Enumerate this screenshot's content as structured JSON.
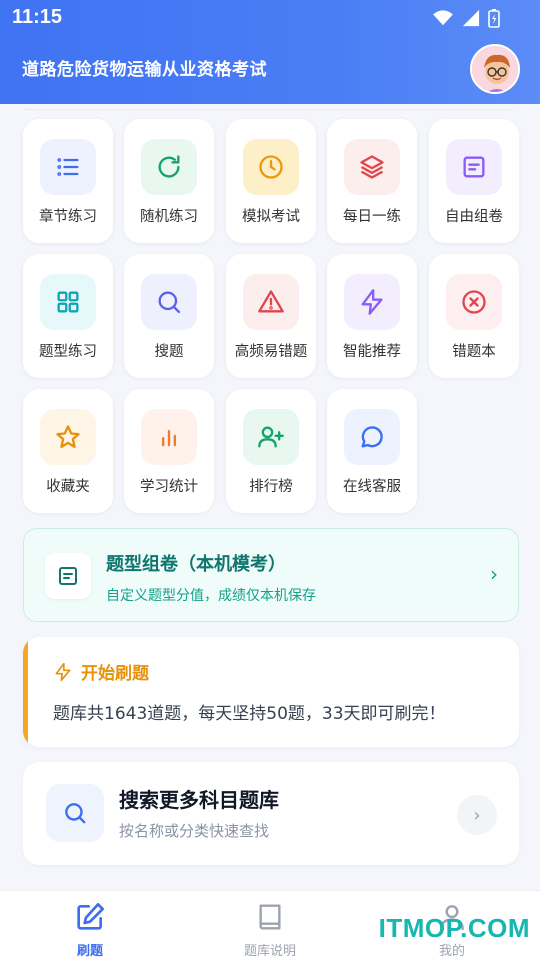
{
  "status_bar": {
    "time": "11:15"
  },
  "header": {
    "title": "道路危险货物运输从业资格考试"
  },
  "grid": [
    {
      "label": "章节练习",
      "icon": "list-icon",
      "bg": "#edf2fe",
      "color": "#3b6ef0"
    },
    {
      "label": "随机练习",
      "icon": "refresh-icon",
      "bg": "#e8f8f1",
      "color": "#16a36a"
    },
    {
      "label": "模拟考试",
      "icon": "clock-icon",
      "bg": "#fdefc8",
      "color": "#e89a0c"
    },
    {
      "label": "每日一练",
      "icon": "layers-icon",
      "bg": "#fdeeee",
      "color": "#e0474c"
    },
    {
      "label": "自由组卷",
      "icon": "file-text-icon",
      "bg": "#f2eefe",
      "color": "#8b5cf6"
    },
    {
      "label": "题型练习",
      "icon": "grid-icon",
      "bg": "#e6f8fa",
      "color": "#0ea5b7"
    },
    {
      "label": "搜题",
      "icon": "search-icon",
      "bg": "#eef0fd",
      "color": "#5b63e6"
    },
    {
      "label": "高频易错题",
      "icon": "alert-triangle-icon",
      "bg": "#fdeeee",
      "color": "#e0474c"
    },
    {
      "label": "智能推荐",
      "icon": "zap-icon",
      "bg": "#f2eefe",
      "color": "#8b5cf6"
    },
    {
      "label": "错题本",
      "icon": "x-circle-icon",
      "bg": "#fdeef0",
      "color": "#e0474c"
    },
    {
      "label": "收藏夹",
      "icon": "star-icon",
      "bg": "#fef5e6",
      "color": "#e8920c"
    },
    {
      "label": "学习统计",
      "icon": "bar-chart-icon",
      "bg": "#fff2ea",
      "color": "#f07a2f"
    },
    {
      "label": "排行榜",
      "icon": "user-plus-icon",
      "bg": "#e8f8f1",
      "color": "#16a36a"
    },
    {
      "label": "在线客服",
      "icon": "message-circle-icon",
      "bg": "#edf2fe",
      "color": "#3b6ef0"
    }
  ],
  "banner": {
    "title": "题型组卷（本机模考）",
    "subtitle": "自定义题型分值，成绩仅本机保存",
    "chevron": "›"
  },
  "start_card": {
    "title": "开始刷题",
    "text": "题库共1643道题，每天坚持50题，33天即可刷完！"
  },
  "search_card": {
    "title": "搜索更多科目题库",
    "subtitle": "按名称或分类快速查找",
    "chevron": "›"
  },
  "bottom_nav": [
    {
      "label": "刷题",
      "active": true
    },
    {
      "label": "题库说明",
      "active": false
    },
    {
      "label": "我的",
      "active": false
    }
  ],
  "watermark": "ITMOP.COM"
}
